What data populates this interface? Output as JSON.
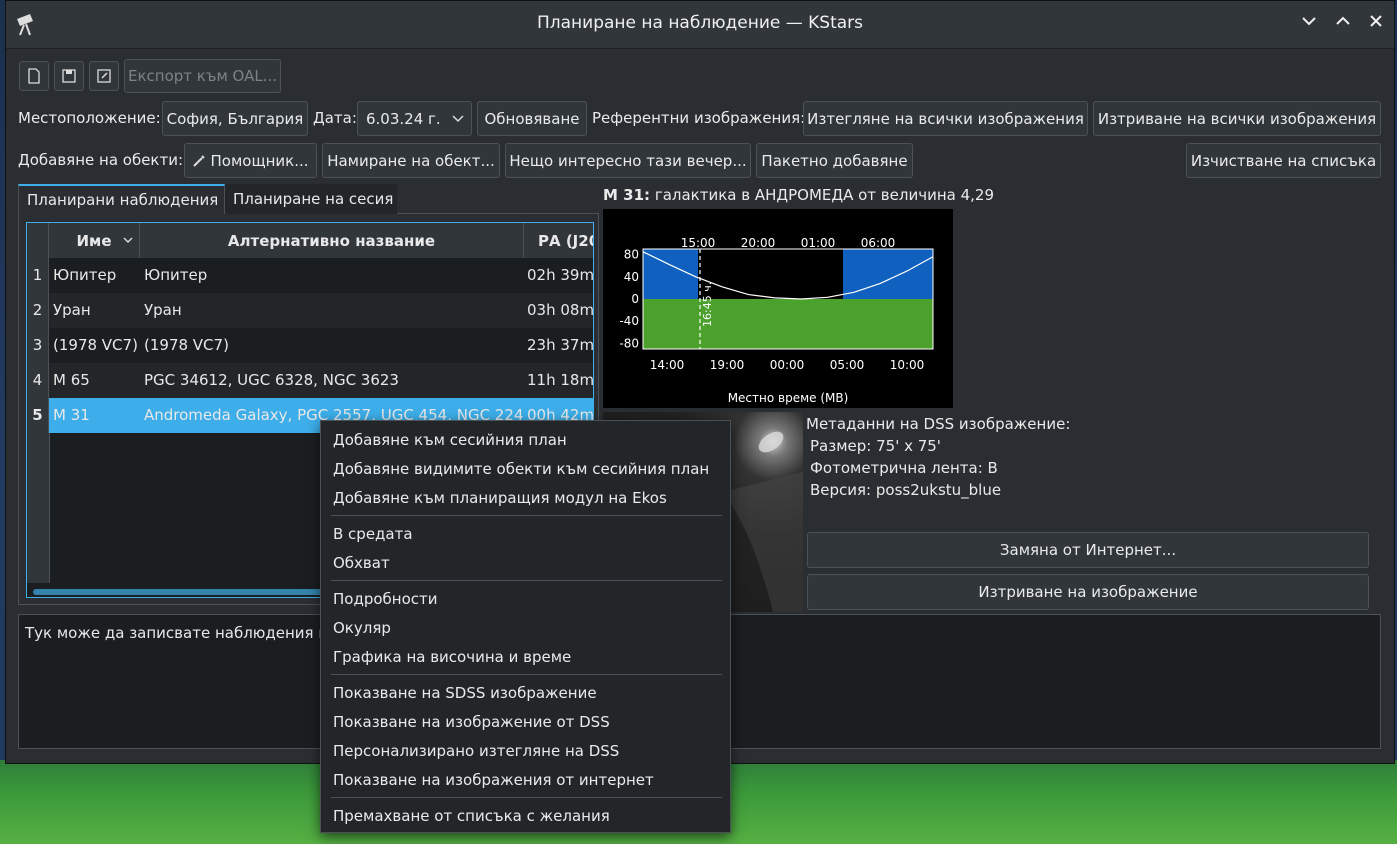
{
  "window": {
    "title": "Планиране на наблюдение — KStars"
  },
  "toolbar": {
    "export_label": "Експорт към OAL..."
  },
  "location": {
    "label": "Местоположение:",
    "value": "София, България"
  },
  "date": {
    "label": "Дата:",
    "value": "6.03.24 г."
  },
  "buttons": {
    "refresh": "Обновяване",
    "ref_images_label": "Референтни изображения:",
    "download_all": "Изтегляне на всички изображения",
    "delete_all": "Изтриване на всички изображения",
    "add_objects_label": "Добавяне на обекти:",
    "wizard": "Помощник...",
    "find_object": "Намиране на обект...",
    "interesting": "Нещо интересно тази вечер...",
    "batch_add": "Пакетно добавяне",
    "clear_list": "Изчистване на списъка"
  },
  "tabs": [
    "Планирани наблюдения",
    "Планиране на сесия"
  ],
  "table": {
    "headers": [
      "Име",
      "Алтернативно название",
      "РА (J20"
    ],
    "rows": [
      {
        "n": "1",
        "name": "Юпитер",
        "alt": "Юпитер",
        "ra": "02h 39m"
      },
      {
        "n": "2",
        "name": "Уран",
        "alt": "Уран",
        "ra": "03h 08m"
      },
      {
        "n": "3",
        "name": "(1978 VC7)",
        "alt": "(1978 VC7)",
        "ra": "23h 37m"
      },
      {
        "n": "4",
        "name": "M 65",
        "alt": "PGC 34612, UGC 6328, NGC 3623",
        "ra": "11h 18m"
      },
      {
        "n": "5",
        "name": "M 31",
        "alt": "Andromeda Galaxy, PGC 2557, UGC 454, NGC 224",
        "ra": "00h 42m"
      }
    ]
  },
  "object_info": {
    "name": "M 31:",
    "desc": "галактика в АНДРОМЕДА от величина 4,29"
  },
  "chart_data": {
    "type": "line",
    "top_ticks": [
      "15:00",
      "20:00",
      "01:00",
      "06:00"
    ],
    "bottom_ticks": [
      "14:00",
      "19:00",
      "00:00",
      "05:00",
      "10:00"
    ],
    "y_ticks": [
      "80",
      "40",
      "0",
      "-40",
      "-80"
    ],
    "ylim": [
      -90,
      90
    ],
    "xlabel": "Местно време (МВ)",
    "marker_label": "16:45 ч.",
    "series": [
      {
        "values": [
          85,
          62,
          40,
          22,
          8,
          2,
          0,
          3,
          12,
          28,
          50,
          76
        ]
      }
    ],
    "colors": {
      "sky": "#1060c0",
      "ground": "#4ca02c",
      "night": "#000000",
      "curve": "#ffffff"
    }
  },
  "dss_meta": {
    "title": "Метаданни на DSS изображение:",
    "size": "Размер: 75' x 75'",
    "band": "Фотометрична лента: B",
    "version": "Версия: poss2ukstu_blue"
  },
  "image_buttons": {
    "replace": "Замяна от Интернет...",
    "delete": "Изтриване на изображение"
  },
  "notes": {
    "text": "Тук може да записвате наблюдения и/"
  },
  "context_menu": {
    "groups": [
      [
        "Добавяне към сесийния план",
        "Добавяне видимите обекти към сесийния план",
        "Добавяне към планиращия модул на Ekos"
      ],
      [
        "В средата",
        "Обхват"
      ],
      [
        "Подробности",
        "Окуляр",
        "Графика на височина и време"
      ],
      [
        "Показване на SDSS изображение",
        "Показване на изображение от DSS",
        "Персонализирано изтегляне на DSS",
        "Показване на изображения от интернет"
      ],
      [
        "Премахване от списъка с желания"
      ]
    ]
  }
}
